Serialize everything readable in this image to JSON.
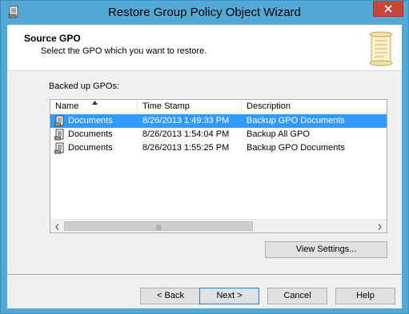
{
  "window": {
    "title": "Restore Group Policy Object Wizard"
  },
  "header": {
    "title": "Source GPO",
    "subtitle": "Select the GPO which you want to restore."
  },
  "list": {
    "label": "Backed up GPOs:",
    "columns": [
      "Name",
      "Time Stamp",
      "Description"
    ],
    "sort_column": "Name",
    "rows": [
      {
        "name": "Documents",
        "timestamp": "8/26/2013 1:49:33 PM",
        "description": "Backup GPO Documents",
        "selected": true
      },
      {
        "name": "Documents",
        "timestamp": "8/26/2013 1:54:04 PM",
        "description": "Backup All GPO",
        "selected": false
      },
      {
        "name": "Documents",
        "timestamp": "8/26/2013 1:55:25 PM",
        "description": "Backup GPO Documents",
        "selected": false
      }
    ]
  },
  "buttons": {
    "view_settings": "View Settings...",
    "back": "< Back",
    "next": "Next >",
    "cancel": "Cancel",
    "help": "Help"
  },
  "colors": {
    "title_bar": "#53a9d6",
    "close_button": "#c7463a",
    "selection": "#3399ff"
  }
}
